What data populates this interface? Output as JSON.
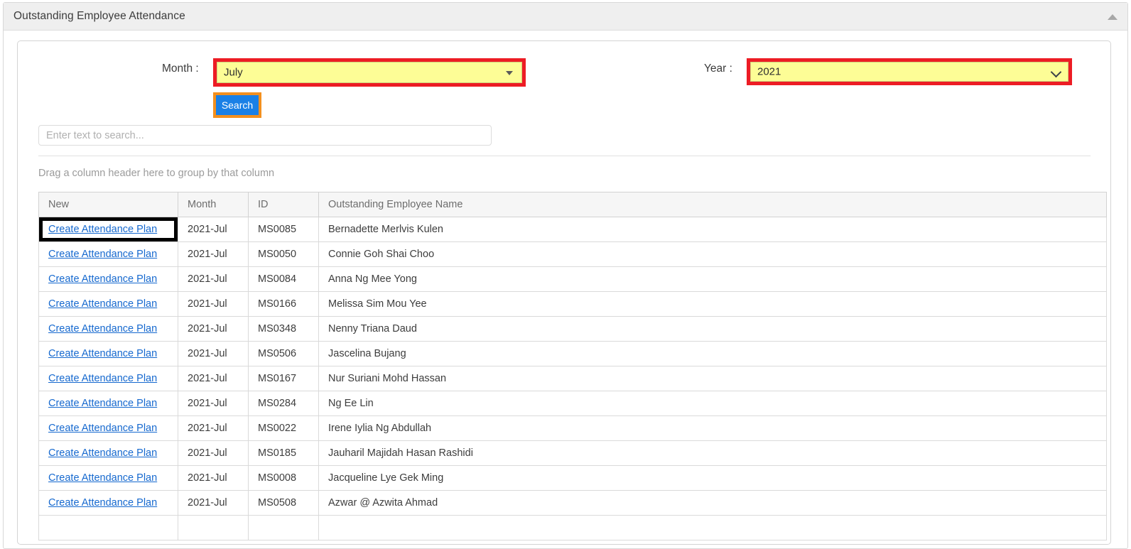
{
  "card": {
    "title": "Outstanding Employee Attendance",
    "collapse_icon": "triangle-up-icon"
  },
  "filters": {
    "month_label": "Month :",
    "month_value": "July",
    "month_caret_icon": "triangle-down-icon",
    "year_label": "Year :",
    "year_value": "2021",
    "year_caret_icon": "chevron-down-icon",
    "search_button_label": "Search",
    "highlight_colors": {
      "field_highlight_border": "#ed1c24",
      "field_fill": "#fdfd96",
      "button_highlight_border": "#f4901e",
      "button_fill": "#1a80e6",
      "focus_outline": "#000000"
    }
  },
  "grid_search": {
    "placeholder": "Enter text to search...",
    "value": ""
  },
  "grid": {
    "group_hint": "Drag a column header here to group by that column",
    "columns": [
      "New",
      "Month",
      "ID",
      "Outstanding Employee Name"
    ],
    "rows": [
      {
        "new": "Create Attendance Plan",
        "month": "2021-Jul",
        "id": "MS0085",
        "name": "Bernadette Merlvis Kulen"
      },
      {
        "new": "Create Attendance Plan",
        "month": "2021-Jul",
        "id": "MS0050",
        "name": "Connie Goh Shai Choo"
      },
      {
        "new": "Create Attendance Plan",
        "month": "2021-Jul",
        "id": "MS0084",
        "name": "Anna Ng Mee Yong"
      },
      {
        "new": "Create Attendance Plan",
        "month": "2021-Jul",
        "id": "MS0166",
        "name": "Melissa Sim Mou Yee"
      },
      {
        "new": "Create Attendance Plan",
        "month": "2021-Jul",
        "id": "MS0348",
        "name": "Nenny Triana Daud"
      },
      {
        "new": "Create Attendance Plan",
        "month": "2021-Jul",
        "id": "MS0506",
        "name": "Jascelina Bujang"
      },
      {
        "new": "Create Attendance Plan",
        "month": "2021-Jul",
        "id": "MS0167",
        "name": "Nur Suriani Mohd Hassan"
      },
      {
        "new": "Create Attendance Plan",
        "month": "2021-Jul",
        "id": "MS0284",
        "name": "Ng Ee Lin"
      },
      {
        "new": "Create Attendance Plan",
        "month": "2021-Jul",
        "id": "MS0022",
        "name": "Irene Iylia Ng Abdullah"
      },
      {
        "new": "Create Attendance Plan",
        "month": "2021-Jul",
        "id": "MS0185",
        "name": "Jauharil Majidah Hasan Rashidi"
      },
      {
        "new": "Create Attendance Plan",
        "month": "2021-Jul",
        "id": "MS0008",
        "name": "Jacqueline Lye Gek Ming"
      },
      {
        "new": "Create Attendance Plan",
        "month": "2021-Jul",
        "id": "MS0508",
        "name": "Azwar @ Azwita Ahmad"
      },
      {
        "new": "",
        "month": "",
        "id": "",
        "name": ""
      }
    ],
    "focused_row_index": 0
  }
}
